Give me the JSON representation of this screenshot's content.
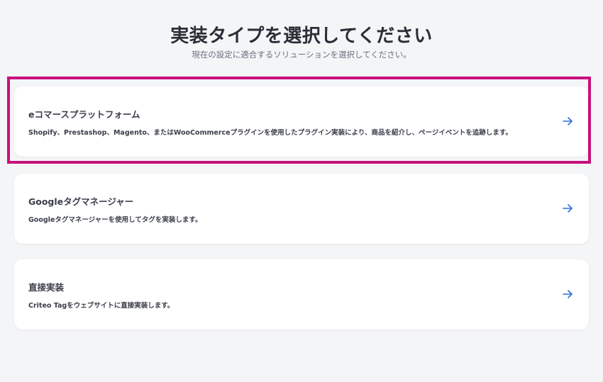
{
  "header": {
    "title": "実装タイプを選択してください",
    "subtitle": "現在の設定に適合するソリューションを選択してください。"
  },
  "options": [
    {
      "title": "eコマースプラットフォーム",
      "description": "Shopify、Prestashop、Magento、またはWooCommerceプラグインを使用したプラグイン実装により、商品を紹介し、ページイベントを追跡します。",
      "icon": "arrow-right-icon",
      "highlighted": true
    },
    {
      "title": "Googleタグマネージャー",
      "description": "Googleタグマネージャーを使用してタグを実装します。",
      "icon": "arrow-right-icon",
      "highlighted": false
    },
    {
      "title": "直接実装",
      "description": "Criteo Tagをウェブサイトに直接実装します。",
      "icon": "arrow-right-icon",
      "highlighted": false
    }
  ],
  "colors": {
    "background": "#f4f5f7",
    "card": "#ffffff",
    "highlight": "#c8107e",
    "arrow": "#2f6fd6"
  }
}
